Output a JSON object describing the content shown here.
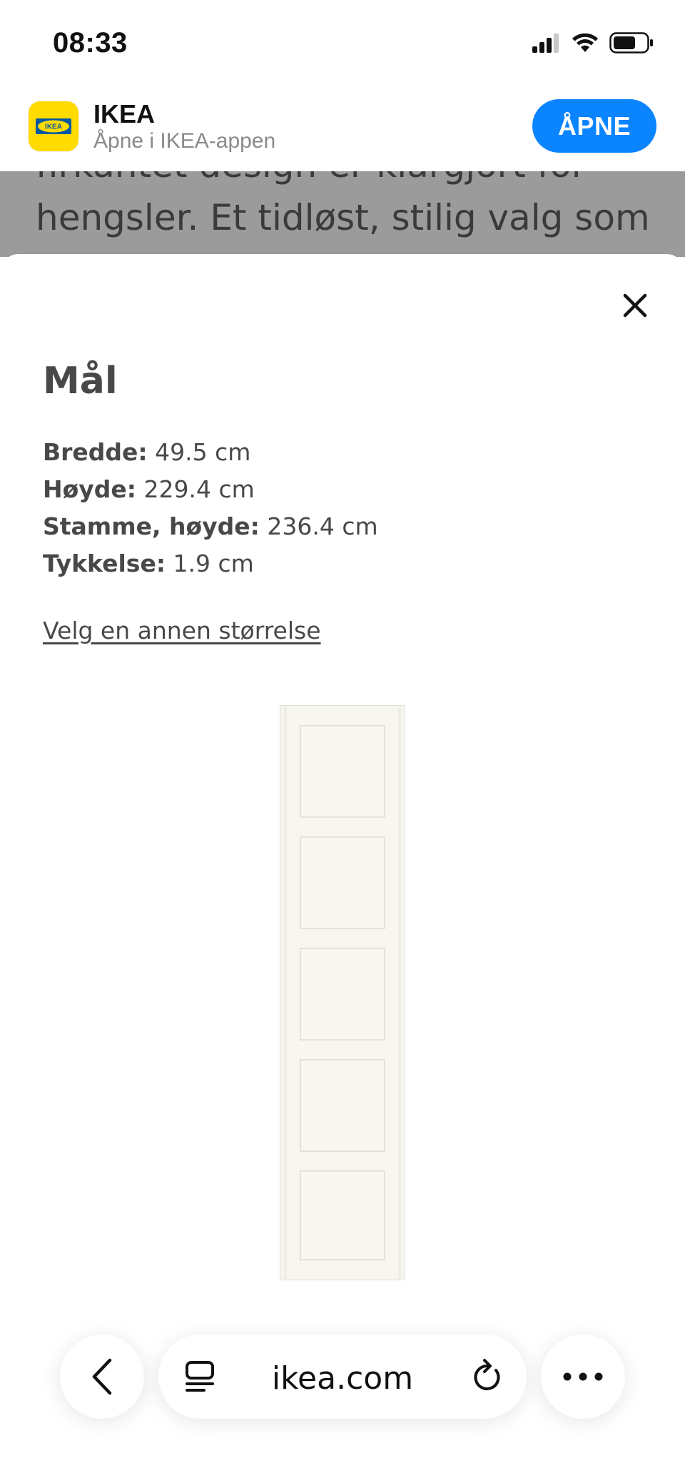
{
  "status_bar": {
    "time": "08:33"
  },
  "app_banner": {
    "app_name": "IKEA",
    "subtitle": "Åpne i IKEA-appen",
    "logo_text": "IKEA",
    "open_label": "ÅPNE"
  },
  "background_page": {
    "line1": "firkantet design er klargjort for",
    "line2": "hengsler. Et tidløst, stilig valg som"
  },
  "sheet": {
    "title": "Mål",
    "dimensions": [
      {
        "label": "Bredde:",
        "value": "49.5 cm"
      },
      {
        "label": "Høyde:",
        "value": "229.4 cm"
      },
      {
        "label": "Stamme, høyde:",
        "value": "236.4 cm"
      },
      {
        "label": "Tykkelse:",
        "value": "1.9 cm"
      }
    ],
    "size_link": "Velg en annen størrelse"
  },
  "toolbar": {
    "url": "ikea.com"
  },
  "colors": {
    "accent_blue": "#0a84ff",
    "ikea_yellow": "#ffdb00",
    "ikea_blue": "#0058a3",
    "door_white": "#f6f5ee"
  }
}
